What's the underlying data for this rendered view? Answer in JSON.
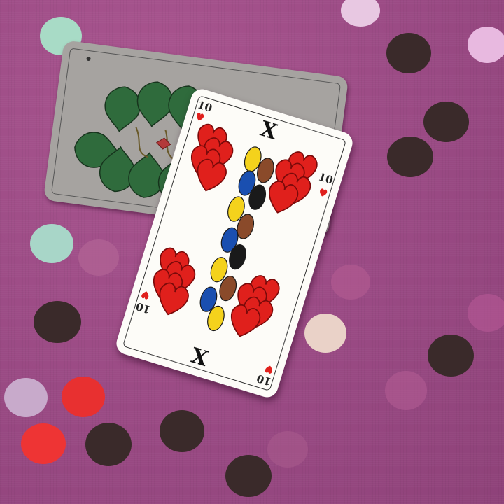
{
  "front_card": {
    "index_top_left": "10",
    "index_top_right": "10",
    "index_bottom_left": "10",
    "index_bottom_right": "10",
    "roman_top": "X",
    "roman_bottom": "X",
    "suit": "hearts"
  },
  "back_card": {
    "suit": "leaves"
  },
  "colors": {
    "tablecloth": "#9d4c86",
    "back_card": "#a6a3a0",
    "front_card": "#fdfcf8",
    "heart_red": "#e0201c",
    "leaf_green": "#2f6b3c",
    "yellow": "#f4d21c",
    "blue": "#1a4fb0"
  }
}
